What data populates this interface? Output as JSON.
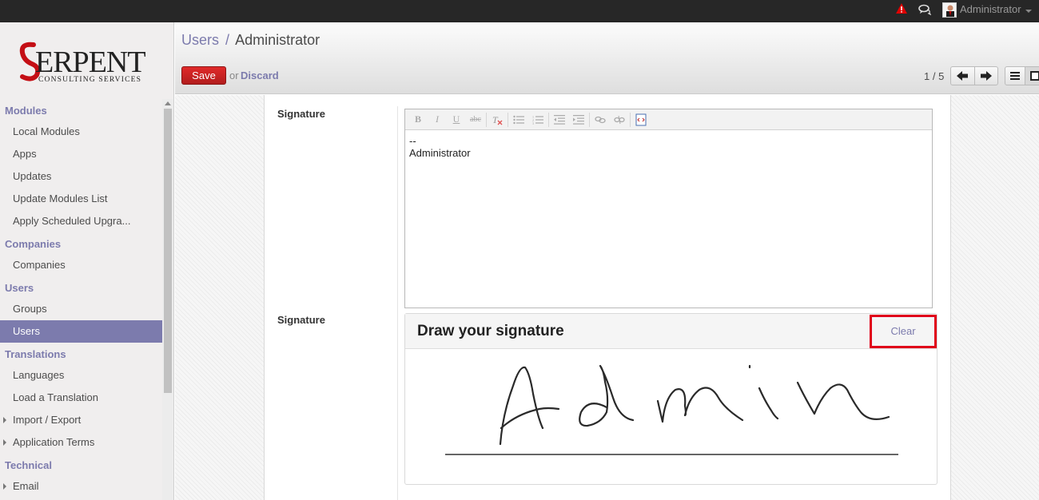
{
  "topbar": {
    "user_name": "Administrator",
    "icons": [
      "alert-icon",
      "chat-icon",
      "user-avatar",
      "caret-down-icon"
    ]
  },
  "logo": {
    "brand": "SERPENT",
    "tagline": "CONSULTING SERVICES"
  },
  "sidebar": {
    "sections": [
      {
        "title": "Modules",
        "items": [
          "Local Modules",
          "Apps",
          "Updates",
          "Update Modules List",
          "Apply Scheduled Upgra..."
        ]
      },
      {
        "title": "Companies",
        "items": [
          "Companies"
        ]
      },
      {
        "title": "Users",
        "items": [
          "Groups",
          "Users"
        ]
      },
      {
        "title": "Translations",
        "items": [
          "Languages",
          "Load a Translation",
          "Import / Export",
          "Application Terms"
        ]
      },
      {
        "title": "Technical",
        "items": [
          "Email"
        ]
      }
    ],
    "active_item": "Users"
  },
  "header": {
    "breadcrumb_parent": "Users",
    "breadcrumb_separator": "/",
    "breadcrumb_current": "Administrator",
    "save_label": "Save",
    "or_text": "or",
    "discard_label": "Discard",
    "pager": "1 / 5"
  },
  "form": {
    "signature_label": "Signature",
    "signature_text_line1": "--",
    "signature_text_line2": "Administrator",
    "drawn_signature_label": "Signature",
    "draw_title": "Draw your signature",
    "clear_label": "Clear",
    "toolbar_buttons": [
      "bold",
      "italic",
      "underline",
      "strikethrough",
      "remove-format",
      "bullet-list",
      "numbered-list",
      "outdent",
      "indent",
      "link",
      "unlink",
      "source-code"
    ]
  },
  "colors": {
    "accent": "#7c7bad",
    "save_button": "#c42020",
    "highlight_box": "#e0001a",
    "topbar": "#272727"
  }
}
